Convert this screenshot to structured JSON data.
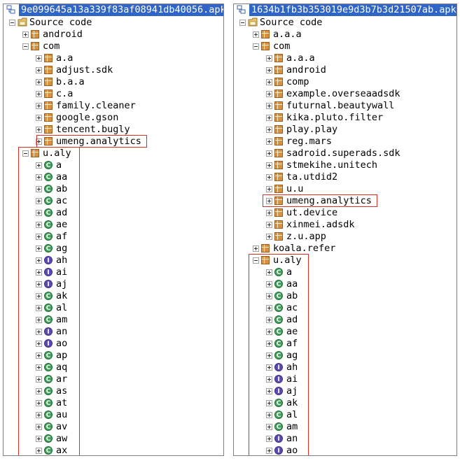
{
  "panels": [
    {
      "file": "9e099645a13a339f83af08941db40056.apk",
      "root": "Source code",
      "top_packages": [
        "android",
        "com"
      ],
      "com_children": [
        "a.a",
        "adjust.sdk",
        "b.a.a",
        "c.a",
        "family.cleaner",
        "google.gson",
        "tencent.bugly",
        "umeng.analytics"
      ],
      "highlighted_package": "umeng.analytics",
      "obf_package": "u.aly",
      "classes": [
        {
          "n": "a",
          "t": "C"
        },
        {
          "n": "aa",
          "t": "C"
        },
        {
          "n": "ab",
          "t": "C"
        },
        {
          "n": "ac",
          "t": "C"
        },
        {
          "n": "ad",
          "t": "C"
        },
        {
          "n": "ae",
          "t": "C"
        },
        {
          "n": "af",
          "t": "C"
        },
        {
          "n": "ag",
          "t": "C"
        },
        {
          "n": "ah",
          "t": "I"
        },
        {
          "n": "ai",
          "t": "I"
        },
        {
          "n": "aj",
          "t": "I"
        },
        {
          "n": "ak",
          "t": "C"
        },
        {
          "n": "al",
          "t": "C"
        },
        {
          "n": "am",
          "t": "C"
        },
        {
          "n": "an",
          "t": "I"
        },
        {
          "n": "ao",
          "t": "I"
        },
        {
          "n": "ap",
          "t": "C"
        },
        {
          "n": "aq",
          "t": "C"
        },
        {
          "n": "ar",
          "t": "C"
        },
        {
          "n": "as",
          "t": "C"
        },
        {
          "n": "at",
          "t": "C"
        },
        {
          "n": "au",
          "t": "C"
        },
        {
          "n": "av",
          "t": "C"
        },
        {
          "n": "aw",
          "t": "C"
        },
        {
          "n": "ax",
          "t": "C"
        }
      ]
    },
    {
      "file": "1634b1fb3b353019e9d3b7b3d21507ab.apk",
      "root": "Source code",
      "top_packages": [
        "a.a.a",
        "com"
      ],
      "com_children": [
        "a.a.a",
        "android",
        "comp",
        "example.overseaadsdk",
        "futurnal.beautywall",
        "kika.pluto.filter",
        "play.play",
        "reg.mars",
        "sadroid.superads.sdk",
        "stmekihe.unitech",
        "ta.utdid2",
        "u.u",
        "umeng.analytics",
        "ut.device",
        "xinmei.adsdk",
        "z.u.app"
      ],
      "after_com": "koala.refer",
      "highlighted_package": "umeng.analytics",
      "obf_package": "u.aly",
      "classes": [
        {
          "n": "a",
          "t": "C"
        },
        {
          "n": "aa",
          "t": "C"
        },
        {
          "n": "ab",
          "t": "C"
        },
        {
          "n": "ac",
          "t": "C"
        },
        {
          "n": "ad",
          "t": "C"
        },
        {
          "n": "ae",
          "t": "C"
        },
        {
          "n": "af",
          "t": "C"
        },
        {
          "n": "ag",
          "t": "C"
        },
        {
          "n": "ah",
          "t": "I"
        },
        {
          "n": "ai",
          "t": "I"
        },
        {
          "n": "aj",
          "t": "I"
        },
        {
          "n": "ak",
          "t": "C"
        },
        {
          "n": "al",
          "t": "C"
        },
        {
          "n": "am",
          "t": "C"
        },
        {
          "n": "an",
          "t": "I"
        },
        {
          "n": "ao",
          "t": "I"
        }
      ]
    }
  ],
  "colors": {
    "selection": "#2f65c4",
    "highlight_box": "#d93025",
    "class_icon": "#3fa35b",
    "interface_icon": "#5b4bb3",
    "package_icon": "#d8913e"
  },
  "icons": {
    "apk": "apk-file-icon",
    "source": "source-folder-icon",
    "package": "package-icon",
    "class": "class-icon",
    "interface": "interface-icon",
    "expander": "tree-expander-icon"
  }
}
